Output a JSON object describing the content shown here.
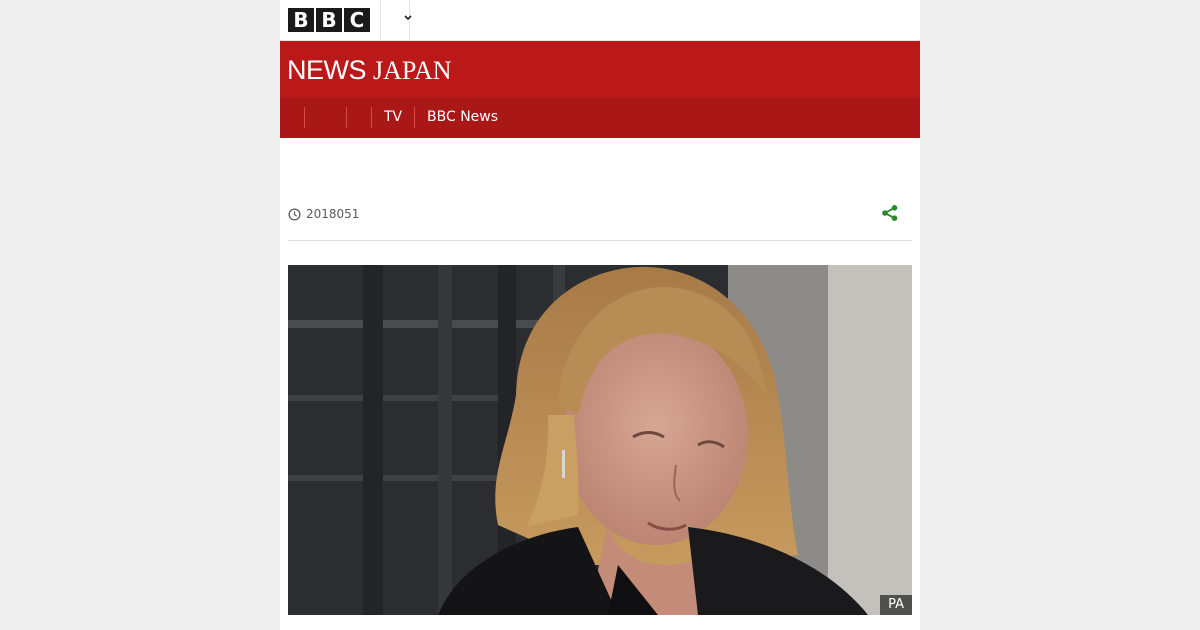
{
  "brand": {
    "bbc_letters": [
      "B",
      "B",
      "C"
    ],
    "news": "NEWS",
    "japan": "JAPAN"
  },
  "top_bar": {
    "more_icon": "chevron-down-icon"
  },
  "nav": {
    "items": [
      {
        "label": ""
      },
      {
        "label": ""
      },
      {
        "label": ""
      },
      {
        "label": "TV"
      },
      {
        "label": "BBC News"
      }
    ]
  },
  "article": {
    "date": "2018051",
    "date_icon": "clock-icon",
    "share_icon": "share-icon",
    "image_credit": "PA"
  },
  "colors": {
    "masthead": "#bb1919",
    "navbar": "#a91717",
    "share": "#2a8a2a",
    "background": "#eeeeee"
  }
}
